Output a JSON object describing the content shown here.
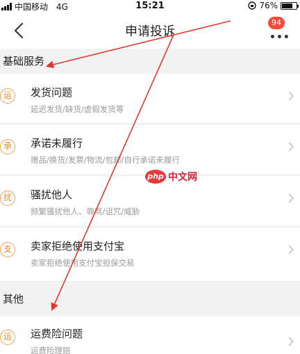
{
  "status_bar": {
    "carrier": "中国移动",
    "network": "4G",
    "time": "15:21",
    "battery_text": "76%",
    "battery_level": 0.76
  },
  "header": {
    "title": "申请投诉",
    "badge_count": "94",
    "more_label": "•••"
  },
  "sections": {
    "basic": {
      "title": "基础服务",
      "items": [
        {
          "icon": "运",
          "title": "发货问题",
          "subtitle": "延迟发货/缺货/虚假发货等"
        },
        {
          "icon": "承",
          "title": "承诺未履行",
          "subtitle": "赠品/换货/发票/物流/包邮/自行承诺未履行"
        },
        {
          "icon": "扰",
          "title": "骚扰他人",
          "subtitle": "频繁骚扰他人、辱骂/诅咒/威胁"
        },
        {
          "icon": "支",
          "title": "卖家拒绝使用支付宝",
          "subtitle": "卖家拒绝使用支付宝担保交易"
        }
      ]
    },
    "other": {
      "title": "其他",
      "items": [
        {
          "icon": "运",
          "title": "运费险问题",
          "subtitle": "运费险理赔"
        }
      ]
    }
  },
  "watermark": {
    "logo": "php",
    "text": "中文网"
  },
  "colors": {
    "accent_orange": "#f08c24",
    "badge_red": "#ff4a3a",
    "arrow_red": "#e0392f"
  }
}
